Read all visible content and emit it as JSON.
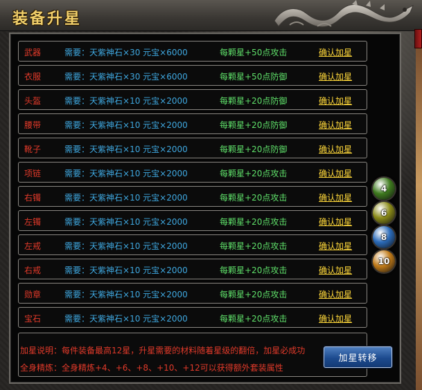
{
  "window": {
    "title": "装备升星"
  },
  "rows": [
    {
      "name": "武器",
      "req_label": "需要：",
      "req": "天紫神石×30 元宝×6000",
      "bonus": "每颗星+50点攻击",
      "action": "确认加星"
    },
    {
      "name": "衣服",
      "req_label": "需要：",
      "req": "天紫神石×30 元宝×6000",
      "bonus": "每颗星+50点防御",
      "action": "确认加星"
    },
    {
      "name": "头盔",
      "req_label": "需要：",
      "req": "天紫神石×10 元宝×2000",
      "bonus": "每颗星+20点防御",
      "action": "确认加星"
    },
    {
      "name": "腰带",
      "req_label": "需要：",
      "req": "天紫神石×10 元宝×2000",
      "bonus": "每颗星+20点防御",
      "action": "确认加星"
    },
    {
      "name": "靴子",
      "req_label": "需要：",
      "req": "天紫神石×10 元宝×2000",
      "bonus": "每颗星+20点防御",
      "action": "确认加星"
    },
    {
      "name": "项链",
      "req_label": "需要：",
      "req": "天紫神石×10 元宝×2000",
      "bonus": "每颗星+20点攻击",
      "action": "确认加星"
    },
    {
      "name": "右镯",
      "req_label": "需要：",
      "req": "天紫神石×10 元宝×2000",
      "bonus": "每颗星+20点攻击",
      "action": "确认加星"
    },
    {
      "name": "左镯",
      "req_label": "需要：",
      "req": "天紫神石×10 元宝×2000",
      "bonus": "每颗星+20点攻击",
      "action": "确认加星"
    },
    {
      "name": "左戒",
      "req_label": "需要：",
      "req": "天紫神石×10 元宝×2000",
      "bonus": "每颗星+20点攻击",
      "action": "确认加星"
    },
    {
      "name": "右戒",
      "req_label": "需要：",
      "req": "天紫神石×10 元宝×2000",
      "bonus": "每颗星+20点攻击",
      "action": "确认加星"
    },
    {
      "name": "勋章",
      "req_label": "需要：",
      "req": "天紫神石×10 元宝×2000",
      "bonus": "每颗星+20点攻击",
      "action": "确认加星"
    },
    {
      "name": "宝石",
      "req_label": "需要：",
      "req": "天紫神石×10 元宝×2000",
      "bonus": "每颗星+20点攻击",
      "action": "确认加星"
    }
  ],
  "gems": [
    {
      "label": "4",
      "color": "#3e7a1e",
      "icon": "green-gem-icon"
    },
    {
      "label": "6",
      "color": "#8a8a18",
      "icon": "yellow-green-gem-icon"
    },
    {
      "label": "8",
      "color": "#2a6ab8",
      "icon": "blue-gem-icon"
    },
    {
      "label": "10",
      "color": "#c07a18",
      "icon": "orange-gem-icon"
    }
  ],
  "info": {
    "line1": "加星说明：每件装备最高12星，升星需要的材料随着星级的翻倍，加星必成功",
    "line2": "全身精炼：全身精炼+4、+6、+8、+10、+12可以获得额外套装属性"
  },
  "transfer_button": "加星转移",
  "colors": {
    "title": "#f2d06b",
    "item_name": "#e23a2a",
    "requirement": "#3fa8e0",
    "bonus": "#5fe06a",
    "action_link": "#ffd83a",
    "button": "#1c4a8e"
  }
}
